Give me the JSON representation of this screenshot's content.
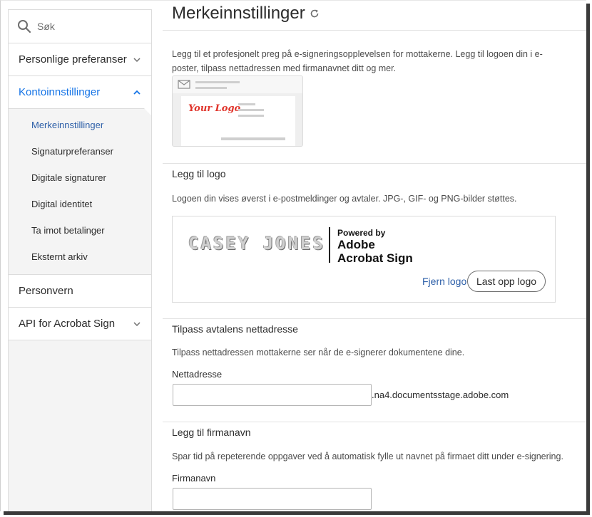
{
  "sidebar": {
    "search_placeholder": "Søk",
    "items": [
      {
        "label": "Personlige preferanser"
      },
      {
        "label": "Kontoinnstillinger"
      },
      {
        "label": "Personvern"
      },
      {
        "label": "API for Acrobat Sign"
      }
    ],
    "sub_items": [
      {
        "label": "Merkeinnstillinger"
      },
      {
        "label": "Signaturpreferanser"
      },
      {
        "label": "Digitale signaturer"
      },
      {
        "label": "Digital identitet"
      },
      {
        "label": "Ta imot betalinger"
      },
      {
        "label": "Eksternt arkiv"
      }
    ]
  },
  "main": {
    "title": "Merkeinnstillinger",
    "intro": "Legg til et profesjonelt preg på e-signeringsopplevelsen for mottakerne. Legg til logoen din i e-poster, tilpass nettadressen med firmanavnet ditt og mer.",
    "preview_logo_text": "Your Logo",
    "logo_section": {
      "heading": "Legg til logo",
      "description": "Logoen din vises øverst i e-postmeldinger og avtaler. JPG-, GIF- og PNG-bilder støttes.",
      "current_logo_text": "CASEY JONES",
      "powered_by": "Powered by",
      "adobe_line1": "Adobe",
      "adobe_line2": "Acrobat Sign",
      "remove_label": "Fjern logo",
      "upload_label": "Last opp logo"
    },
    "url_section": {
      "heading": "Tilpass avtalens nettadresse",
      "description": "Tilpass nettadressen mottakerne ser når de e-signerer dokumentene dine.",
      "field_label": "Nettadresse",
      "field_value": "",
      "domain_suffix": ".na4.documentsstage.adobe.com"
    },
    "company_section": {
      "heading": "Legg til firmanavn",
      "description": "Spar tid på repeterende oppgaver ved å automatisk fylle ut navnet på firmaet ditt under e-signering.",
      "field_label": "Firmanavn",
      "field_value": ""
    }
  },
  "colors": {
    "accent": "#1473e6",
    "link": "#2d5fa8",
    "logo_red": "#e0342b"
  }
}
